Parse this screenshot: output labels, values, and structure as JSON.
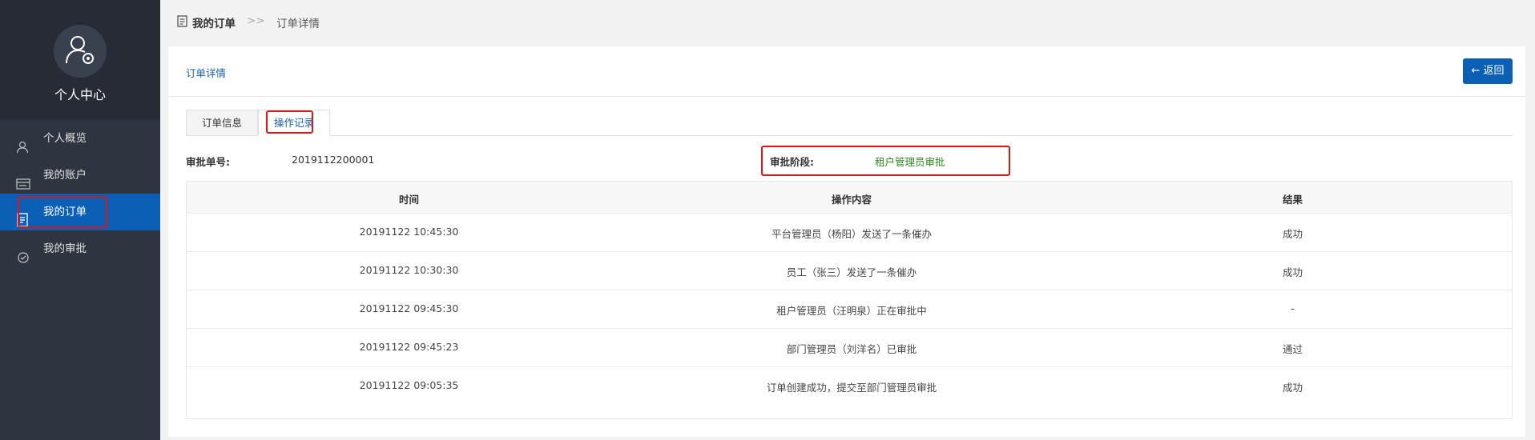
{
  "sidebar": {
    "profile_title": "个人中心",
    "items": [
      {
        "label": "个人概览",
        "icon": "user-icon",
        "active": false
      },
      {
        "label": "我的账户",
        "icon": "account-card-icon",
        "active": false
      },
      {
        "label": "我的订单",
        "icon": "order-doc-icon",
        "active": true
      },
      {
        "label": "我的审批",
        "icon": "approval-icon",
        "active": false
      }
    ]
  },
  "breadcrumb": {
    "root": "我的订单",
    "separator": ">>",
    "current": "订单详情"
  },
  "card": {
    "title": "订单详情",
    "back_label": "返回",
    "back_icon": "arrow-left-icon"
  },
  "tabs": [
    {
      "label": "订单信息",
      "active": false
    },
    {
      "label": "操作记录",
      "active": true
    }
  ],
  "info": {
    "approval_no_label": "审批单号:",
    "approval_no_value": "2019112200001",
    "stage_label": "审批阶段:",
    "stage_value": "租户管理员审批"
  },
  "table": {
    "headers": [
      "时间",
      "操作内容",
      "结果"
    ],
    "rows": [
      {
        "time": "20191122 10:45:30",
        "content": "平台管理员（杨阳）发送了一条催办",
        "result": "成功"
      },
      {
        "time": "20191122 10:30:30",
        "content": "员工（张三）发送了一条催办",
        "result": "成功"
      },
      {
        "time": "20191122 09:45:30",
        "content": "租户管理员（汪明泉）正在审批中",
        "result": "-"
      },
      {
        "time": "20191122 09:45:23",
        "content": "部门管理员（刘洋名）已审批",
        "result": "通过"
      },
      {
        "time": "20191122 09:05:35",
        "content": "订单创建成功，提交至部门管理员审批",
        "result": "成功"
      }
    ]
  },
  "colors": {
    "sidebar_bg": "#2e3440",
    "sidebar_active": "#0b60b5",
    "accent_blue": "#1760aa",
    "stage_green": "#2e8b1e",
    "highlight_red": "#e01515"
  }
}
